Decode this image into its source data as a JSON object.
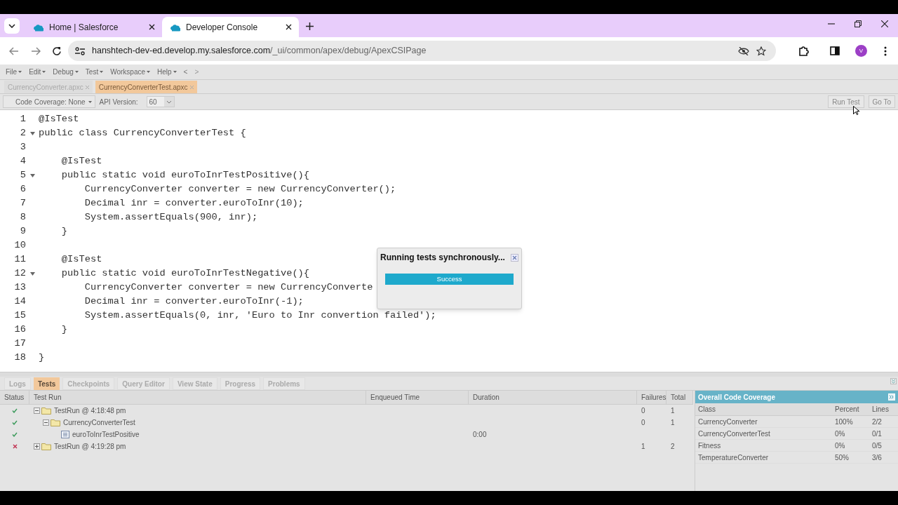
{
  "browser": {
    "tabs": [
      {
        "title": "Home | Salesforce",
        "selected": false
      },
      {
        "title": "Developer Console",
        "selected": true
      }
    ],
    "url": {
      "host": "hanshtech-dev-ed.develop.my.salesforce.com",
      "path": "/_ui/common/apex/debug/ApexCSIPage"
    },
    "profile_initial": "V"
  },
  "menu": [
    "File",
    "Edit",
    "Debug",
    "Test",
    "Workspace",
    "Help"
  ],
  "menu_nav": [
    "<",
    ">"
  ],
  "file_tabs": [
    {
      "label": "CurrencyConverter.apxc",
      "selected": false
    },
    {
      "label": "CurrencyConverterTest.apxc",
      "selected": true
    }
  ],
  "toolbar": {
    "coverage": "Code Coverage: None",
    "api_label": "API Version:",
    "api_value": "60",
    "buttons": [
      "Run Test",
      "Go To"
    ]
  },
  "code_lines": [
    {
      "number": "1",
      "text": "@IsTest",
      "foldable": false
    },
    {
      "number": "2",
      "text": "public class CurrencyConverterTest {",
      "foldable": true
    },
    {
      "number": "3",
      "foldable": false
    },
    {
      "number": "4",
      "text": "    @IsTest",
      "foldable": false
    },
    {
      "number": "5",
      "text": "    public static void euroToInrTestPositive(){",
      "foldable": true
    },
    {
      "number": "6",
      "text": "        CurrencyConverter converter = new CurrencyConverter();",
      "foldable": false
    },
    {
      "number": "7",
      "text": "        Decimal inr = converter.euroToInr(10);",
      "foldable": false
    },
    {
      "number": "8",
      "text": "        System.assertEquals(900, inr);",
      "foldable": false
    },
    {
      "number": "9",
      "text": "    }",
      "foldable": false
    },
    {
      "number": "10",
      "foldable": false
    },
    {
      "number": "11",
      "text": "    @IsTest",
      "foldable": false
    },
    {
      "number": "12",
      "text": "    public static void euroToInrTestNegative(){",
      "foldable": true
    },
    {
      "number": "13",
      "text": "        CurrencyConverter converter = new CurrencyConverte",
      "foldable": false
    },
    {
      "number": "14",
      "text": "        Decimal inr = converter.euroToInr(-1);",
      "foldable": false
    },
    {
      "number": "15",
      "text": "        System.assertEquals(0, inr, 'Euro to Inr convertion failed');",
      "foldable": false
    },
    {
      "number": "16",
      "text": "    }",
      "foldable": false
    },
    {
      "number": "17",
      "foldable": false
    },
    {
      "number": "18",
      "text": "}",
      "foldable": false
    }
  ],
  "dialog": {
    "title": "Running tests synchronously...",
    "progress_label": "Success",
    "level": 1
  },
  "bottom_tabs": [
    {
      "label": "Logs",
      "selected": false
    },
    {
      "label": "Tests",
      "selected": true
    },
    {
      "label": "Checkpoints",
      "selected": false
    },
    {
      "label": "Query Editor",
      "selected": false
    },
    {
      "label": "View State",
      "selected": false
    },
    {
      "label": "Progress",
      "selected": false
    },
    {
      "label": "Problems",
      "selected": false
    }
  ],
  "test_table": {
    "columns": [
      "Status",
      "Test Run",
      "Enqueued Time",
      "Duration",
      "Failures",
      "Total"
    ],
    "rows": [
      {
        "passed": true,
        "kind": "folder",
        "name": "TestRun @ 4:18:48 pm",
        "failures": "0",
        "total": "1",
        "expanded": true,
        "children": [
          {
            "passed": true,
            "kind": "folder",
            "name": "CurrencyConverterTest",
            "failures": "0",
            "total": "1",
            "expanded": true,
            "children": [
              {
                "passed": true,
                "kind": "method",
                "name": "euroToInrTestPositive",
                "duration": "0:00"
              }
            ]
          }
        ]
      },
      {
        "passed": false,
        "kind": "folder",
        "name": "TestRun @ 4:19:28 pm",
        "failures": "1",
        "total": "2",
        "expanded": false
      }
    ]
  },
  "coverage": {
    "title": "Overall Code Coverage",
    "columns": [
      "Class",
      "Percent",
      "Lines"
    ],
    "rows": [
      [
        "CurrencyConverter",
        "100%",
        "2/2"
      ],
      [
        "CurrencyConverterTest",
        "0%",
        "0/1"
      ],
      [
        "Fitness",
        "0%",
        "0/5"
      ],
      [
        "TemperatureConverter",
        "50%",
        "3/6"
      ]
    ]
  }
}
